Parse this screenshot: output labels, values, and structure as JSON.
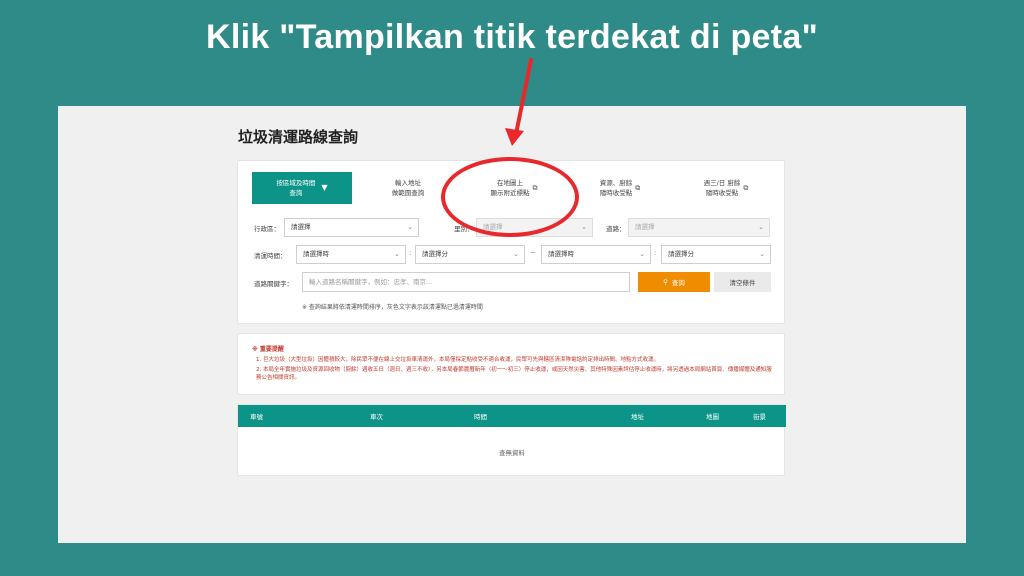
{
  "headline": "Klik \"Tampilkan titik terdekat di peta\"",
  "page": {
    "title": "垃圾清運路線查詢"
  },
  "tabs": [
    {
      "line1": "按區域及時間",
      "line2": "查詢",
      "icon": "caret-down-icon",
      "active": true
    },
    {
      "line1": "輸入地址",
      "line2": "做範圍查詢",
      "icon": "",
      "active": false
    },
    {
      "line1": "在地圖上",
      "line2": "顯示附近標點",
      "icon": "external-link-icon",
      "active": false
    },
    {
      "line1": "資源、廚餘",
      "line2": "隨時收受點",
      "icon": "external-link-icon",
      "active": false
    },
    {
      "line1": "週三/日 廚餘",
      "line2": "隨時收受點",
      "icon": "external-link-icon",
      "active": false
    }
  ],
  "filters": {
    "district_label": "行政區：",
    "district_value": "請選擇",
    "village_label": "里別：",
    "village_value": "請選擇",
    "route_label": "道路：",
    "route_value": "請選擇",
    "time_label": "清運時間：",
    "hour1": "請選擇時",
    "min1": "請選擇分",
    "hour2": "請選擇時",
    "min2": "請選擇分",
    "colon": ":",
    "tilde": "~",
    "keyword_label": "道路關鍵字：",
    "keyword_placeholder": "輸入道路名稱關鍵字，例如：忠孝、南京...",
    "search_button": "查詢",
    "search_icon": "search-icon",
    "clear_button": "清空條件",
    "note": "※ 查詢結果將依清運時間排序，灰色文字表示該清運點已過清運時間"
  },
  "notice": {
    "title": "※ 重要提醒",
    "item1": "1. 巨大垃圾（大型垃圾）因體積較大，除民眾不便在線上交垃圾車清運外，本局僅採定點收受不適合收運，民眾可先與轄區清潔隊電話約定排出時間、地點方式收運。",
    "item2": "2. 本局全年實施垃圾及資源回收物（廚餘）週收五日（週日、週三不收），另本局春節農曆新年（初一～初三）停止收運，或因天然災害、其他特殊因素評估停止收運時，將另透過本局網站首頁、傳播媒體及通知服務公告相關資訊。"
  },
  "table": {
    "columns": [
      "車號",
      "車次",
      "時間",
      "地址",
      "地圖",
      "街景"
    ],
    "empty_text": "查無資料"
  },
  "colors": {
    "background": "#2e8b87",
    "accent": "#0d9488",
    "search_button": "#f08c00",
    "annotation": "#e8282b"
  }
}
